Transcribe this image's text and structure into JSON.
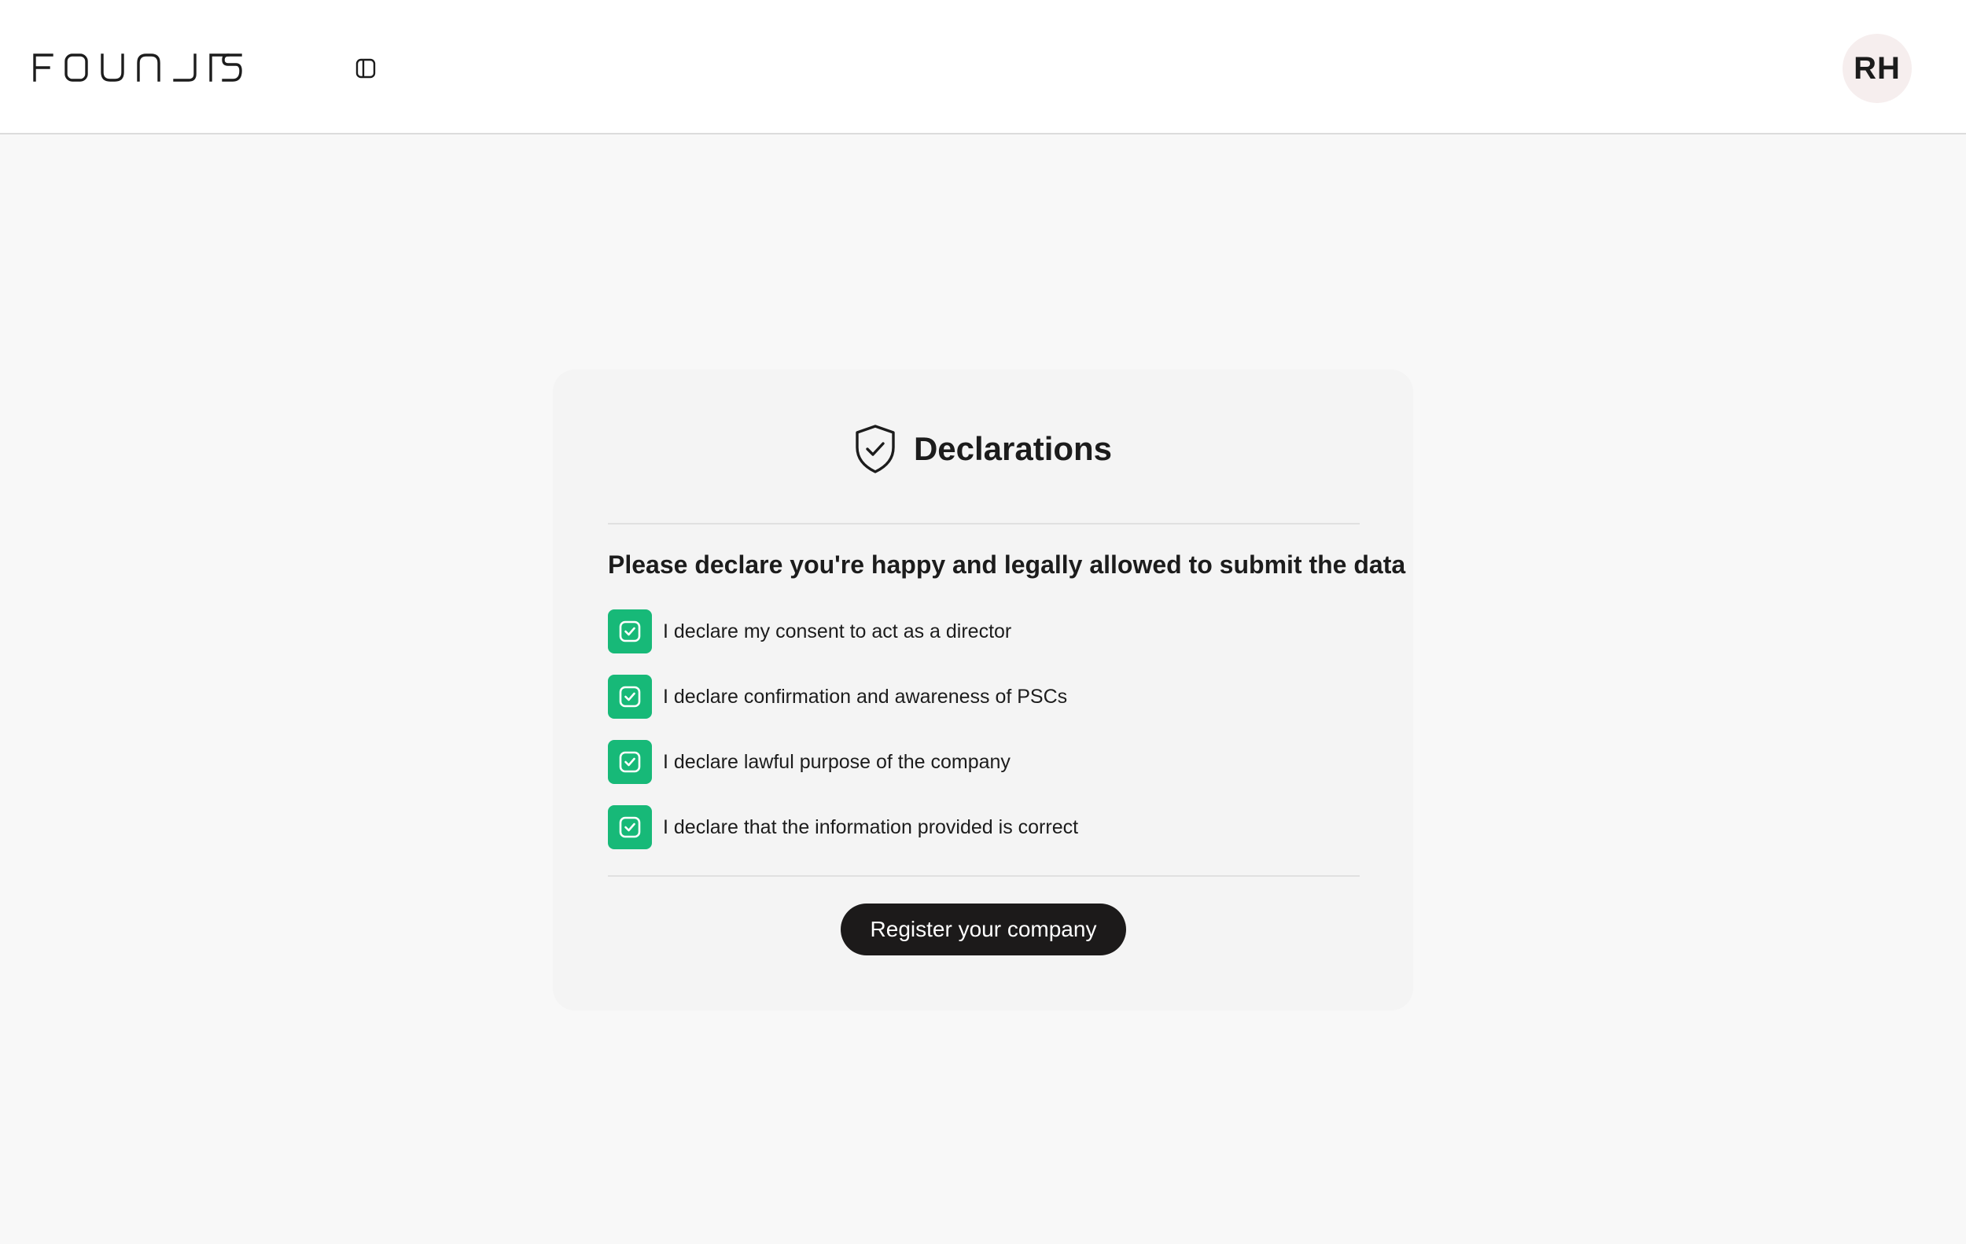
{
  "header": {
    "logo_text": "FOUNDRS",
    "avatar_initials": "RH"
  },
  "card": {
    "title": "Declarations",
    "subtitle": "Please declare you're happy and legally allowed to submit the data",
    "declarations": [
      {
        "label": "I declare my consent to act as a director",
        "checked": true
      },
      {
        "label": "I declare confirmation and awareness of PSCs",
        "checked": true
      },
      {
        "label": "I declare lawful purpose of the company",
        "checked": true
      },
      {
        "label": "I declare that the information provided is correct",
        "checked": true
      }
    ],
    "submit_label": "Register your company"
  },
  "colors": {
    "accent": "#17b978",
    "button_bg": "#1c1a1a",
    "avatar_bg": "#f6eeee"
  },
  "icons": {
    "logo": "foundrs-logo",
    "sidebar_toggle": "sidebar-panel-icon",
    "card_header": "shield-check-icon",
    "checkbox": "check-square-icon"
  }
}
